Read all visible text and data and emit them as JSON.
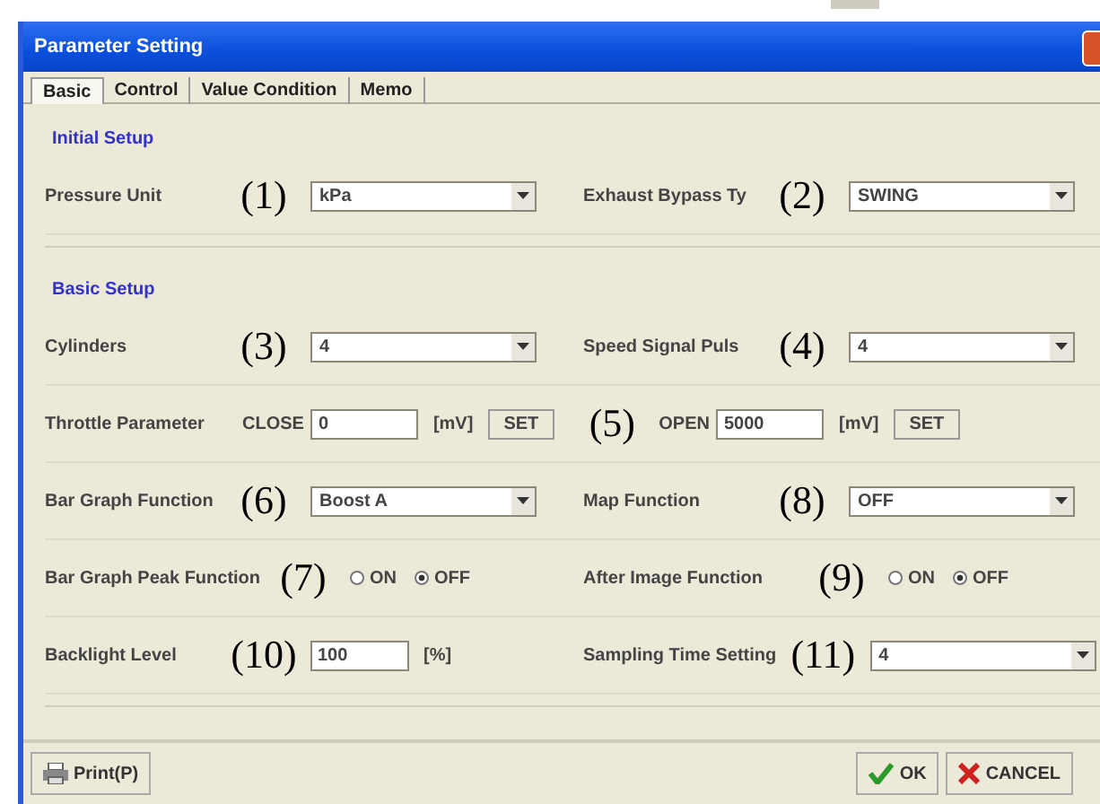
{
  "window": {
    "title": "Parameter Setting"
  },
  "tabs": [
    {
      "label": "Basic",
      "selected": true
    },
    {
      "label": "Control",
      "selected": false
    },
    {
      "label": "Value Condition",
      "selected": false
    },
    {
      "label": "Memo",
      "selected": false
    }
  ],
  "sections": [
    {
      "title": "Initial Setup",
      "rows": [
        [
          {
            "kind": "combo",
            "label": "Pressure Unit",
            "annotation": "(1)",
            "value": "kPa"
          },
          {
            "kind": "combo",
            "label": "Exhaust Bypass Ty",
            "annotation": "(2)",
            "value": "SWING"
          }
        ]
      ]
    },
    {
      "title": "Basic Setup",
      "rows": [
        [
          {
            "kind": "combo",
            "label": "Cylinders",
            "annotation": "(3)",
            "value": "4"
          },
          {
            "kind": "combo",
            "label": "Speed Signal Puls",
            "annotation": "(4)",
            "value": "4"
          }
        ],
        [
          {
            "kind": "throttle",
            "label": "Throttle Parameter",
            "annotation": "(5)",
            "ends": [
              {
                "label": "CLOSE",
                "value": "0",
                "unit": "[mV]",
                "button": "SET"
              },
              {
                "label": "OPEN",
                "value": "5000",
                "unit": "[mV]",
                "button": "SET"
              }
            ]
          }
        ],
        [
          {
            "kind": "combo",
            "label": "Bar Graph Function",
            "annotation": "(6)",
            "value": "Boost A"
          },
          {
            "kind": "combo",
            "label": "Map Function",
            "annotation": "(8)",
            "value": "OFF"
          }
        ],
        [
          {
            "kind": "radio",
            "label": "Bar Graph Peak Function",
            "annotation": "(7)",
            "options": [
              {
                "label": "ON",
                "selected": false
              },
              {
                "label": "OFF",
                "selected": true
              }
            ]
          },
          {
            "kind": "radio",
            "label": "After Image Function",
            "annotation": "(9)",
            "options": [
              {
                "label": "ON",
                "selected": false
              },
              {
                "label": "OFF",
                "selected": true
              }
            ]
          }
        ],
        [
          {
            "kind": "number",
            "label": "Backlight Level",
            "annotation": "(10)",
            "value": "100",
            "unit": "[%]"
          },
          {
            "kind": "combo",
            "label": "Sampling Time Setting",
            "annotation": "(11)",
            "value": "4"
          }
        ]
      ]
    }
  ],
  "buttons": [
    {
      "kind": "print",
      "label": "Print(P)"
    },
    {
      "kind": "ok",
      "label": "OK"
    },
    {
      "kind": "cancel",
      "label": "CANCEL"
    }
  ]
}
